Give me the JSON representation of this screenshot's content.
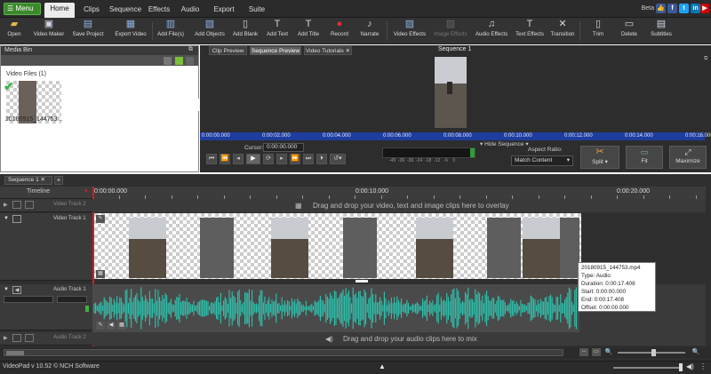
{
  "menu": {
    "label": "Menu"
  },
  "tabs": [
    "Home",
    "Clips",
    "Sequence",
    "Effects",
    "Audio",
    "Export",
    "Suite"
  ],
  "beta": "Beta",
  "social": [
    "like-icon",
    "facebook-icon",
    "twitter-icon",
    "linkedin-icon",
    "youtube-icon"
  ],
  "toolbar": [
    {
      "label": "Open",
      "icon": "folder-icon"
    },
    {
      "label": "Video Maker",
      "icon": "video-maker-icon"
    },
    {
      "label": "Save Project",
      "icon": "save-icon"
    },
    {
      "label": "Export Video",
      "icon": "export-icon"
    },
    {
      "label": "Add File(s)",
      "icon": "add-file-icon"
    },
    {
      "label": "Add Objects",
      "icon": "add-objects-icon"
    },
    {
      "label": "Add Blank",
      "icon": "add-blank-icon"
    },
    {
      "label": "Add Text",
      "icon": "add-text-icon"
    },
    {
      "label": "Add Title",
      "icon": "add-title-icon"
    },
    {
      "label": "Record",
      "icon": "record-icon"
    },
    {
      "label": "Narrate",
      "icon": "narrate-icon"
    },
    {
      "label": "Video Effects",
      "icon": "video-effects-icon"
    },
    {
      "label": "Image Effects",
      "icon": "image-effects-icon"
    },
    {
      "label": "Audio Effects",
      "icon": "audio-effects-icon"
    },
    {
      "label": "Text Effects",
      "icon": "text-effects-icon"
    },
    {
      "label": "Transition",
      "icon": "transition-icon"
    },
    {
      "label": "Trim",
      "icon": "trim-icon"
    },
    {
      "label": "Delete",
      "icon": "delete-icon"
    },
    {
      "label": "Subtitles",
      "icon": "subtitles-icon"
    }
  ],
  "mediabin": {
    "title": "Media Bin",
    "section": "Video Files (1)",
    "file": "20180915_144753..."
  },
  "preview": {
    "tabs": [
      "Clip Preview",
      "Sequence Preview",
      "Video Tutorials"
    ],
    "sequence_title": "Sequence 1",
    "ruler": [
      "0:00:00.000",
      "0:00:02.000",
      "0:00:04.000",
      "0:00:06.000",
      "0:00:08.000",
      "0:00:10.000",
      "0:00:12.000",
      "0:00:14.000",
      "0:00:16.000"
    ],
    "hide_sequence": "Hide Sequence",
    "cursor_label": "Cursor:",
    "cursor_value": "0:00:00.000",
    "meter_scale": "-45  -36  -30  -24  -18  -12   -6    0",
    "aspect_label": "Aspect Ratio:",
    "aspect_value": "Match Content",
    "split": "Split",
    "fit": "Fit",
    "maximize": "Maximize"
  },
  "timeline": {
    "seq_tab": "Sequence 1",
    "label": "Timeline",
    "ruler": [
      "0:00:00.000",
      "0:00:10.000",
      "0:00:20.000"
    ],
    "video_track2": "Video Track 2",
    "video_track1": "Video Track 1",
    "audio_track1": "Audio Track 1",
    "audio_track2": "Audio Track 2",
    "overlay_hint": "Drag and drop your video, text and image clips here to overlay",
    "audio_hint": "Drag and drop your audio clips here to mix"
  },
  "tooltip": {
    "name": "20180915_144753.mp4",
    "type": "Type: Audio",
    "duration": "Duration: 0:00:17.408",
    "start": "Start: 0:00:00.000",
    "end": "End: 0:00:17.408",
    "offset": "Offset: 0:00:00.000"
  },
  "status": {
    "text": "VideoPad v 10.52 © NCH Software"
  },
  "colors": {
    "accent_green": "#3b8a2c",
    "ruler_blue": "#1e3d9e",
    "waveform": "#2ec4b0",
    "playhead": "#d01f1f"
  }
}
